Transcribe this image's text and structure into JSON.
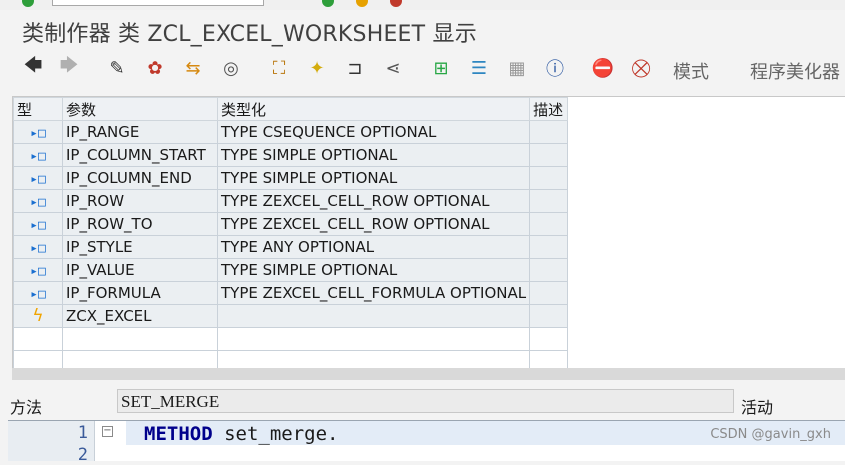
{
  "window": {
    "title": "类制作器 类 ZCL_EXCEL_WORKSHEET 显示"
  },
  "toolbar": {
    "buttons": [
      {
        "name": "back-icon",
        "glyph": "🡄",
        "color": "#333333"
      },
      {
        "name": "forward-icon",
        "glyph": "🡆",
        "color": "#b0b0b0"
      },
      {
        "name": "display-change-icon",
        "glyph": "✎",
        "color": "#333333"
      },
      {
        "name": "activate-icon",
        "glyph": "✿",
        "color": "#c0392b"
      },
      {
        "name": "check-object-icon",
        "glyph": "⇆",
        "color": "#d68910"
      },
      {
        "name": "where-used-icon",
        "glyph": "◎",
        "color": "#555555"
      },
      {
        "name": "object-list-icon",
        "glyph": "⛶",
        "color": "#b9770e"
      },
      {
        "name": "magic-wand-icon",
        "glyph": "✦",
        "color": "#d4ac0d"
      },
      {
        "name": "transport-icon",
        "glyph": "⊐",
        "color": "#333333"
      },
      {
        "name": "split-icon",
        "glyph": "⋖",
        "color": "#555555"
      },
      {
        "name": "hierarchy-icon",
        "glyph": "⊞",
        "color": "#28a745"
      },
      {
        "name": "list-icon",
        "glyph": "☰",
        "color": "#2e86c1"
      },
      {
        "name": "table-icon",
        "glyph": "▦",
        "color": "#999999"
      },
      {
        "name": "info-icon",
        "glyph": "ⓘ",
        "color": "#1f4e9c"
      },
      {
        "name": "stop-breakpoint-icon",
        "glyph": "⛔",
        "color": "#c0392b"
      },
      {
        "name": "session-breakpoint-icon",
        "glyph": "⛒",
        "color": "#c0392b"
      }
    ],
    "text_buttons": {
      "mode": "模式",
      "pretty_printer": "程序美化器"
    }
  },
  "params_grid": {
    "headers": {
      "type": "型",
      "param": "参数",
      "typing": "类型化",
      "desc": "描述"
    },
    "rows": [
      {
        "icon": "▸□",
        "kind": "importing",
        "name": "IP_RANGE",
        "typing": "TYPE CSEQUENCE OPTIONAL",
        "desc": ""
      },
      {
        "icon": "▸□",
        "kind": "importing",
        "name": "IP_COLUMN_START",
        "typing": "TYPE SIMPLE OPTIONAL",
        "desc": ""
      },
      {
        "icon": "▸□",
        "kind": "importing",
        "name": "IP_COLUMN_END",
        "typing": "TYPE SIMPLE OPTIONAL",
        "desc": ""
      },
      {
        "icon": "▸□",
        "kind": "importing",
        "name": "IP_ROW",
        "typing": "TYPE ZEXCEL_CELL_ROW OPTIONAL",
        "desc": ""
      },
      {
        "icon": "▸□",
        "kind": "importing",
        "name": "IP_ROW_TO",
        "typing": "TYPE ZEXCEL_CELL_ROW OPTIONAL",
        "desc": ""
      },
      {
        "icon": "▸□",
        "kind": "importing",
        "name": "IP_STYLE",
        "typing": "TYPE ANY OPTIONAL",
        "desc": ""
      },
      {
        "icon": "▸□",
        "kind": "importing",
        "name": "IP_VALUE",
        "typing": "TYPE SIMPLE OPTIONAL",
        "desc": ""
      },
      {
        "icon": "▸□",
        "kind": "importing",
        "name": "IP_FORMULA",
        "typing": "TYPE ZEXCEL_CELL_FORMULA OPTIONAL",
        "desc": ""
      },
      {
        "icon": "ϟ",
        "kind": "exception",
        "name": "ZCX_EXCEL",
        "typing": "",
        "desc": ""
      }
    ]
  },
  "method_bar": {
    "label": "方法",
    "value": "SET_MERGE",
    "status": "活动"
  },
  "editor": {
    "line_numbers": [
      "1",
      "2"
    ],
    "fold_marker": "−",
    "line1_keyword": "METHOD",
    "line1_rest": " set_merge."
  },
  "watermark": "CSDN @gavin_gxh"
}
